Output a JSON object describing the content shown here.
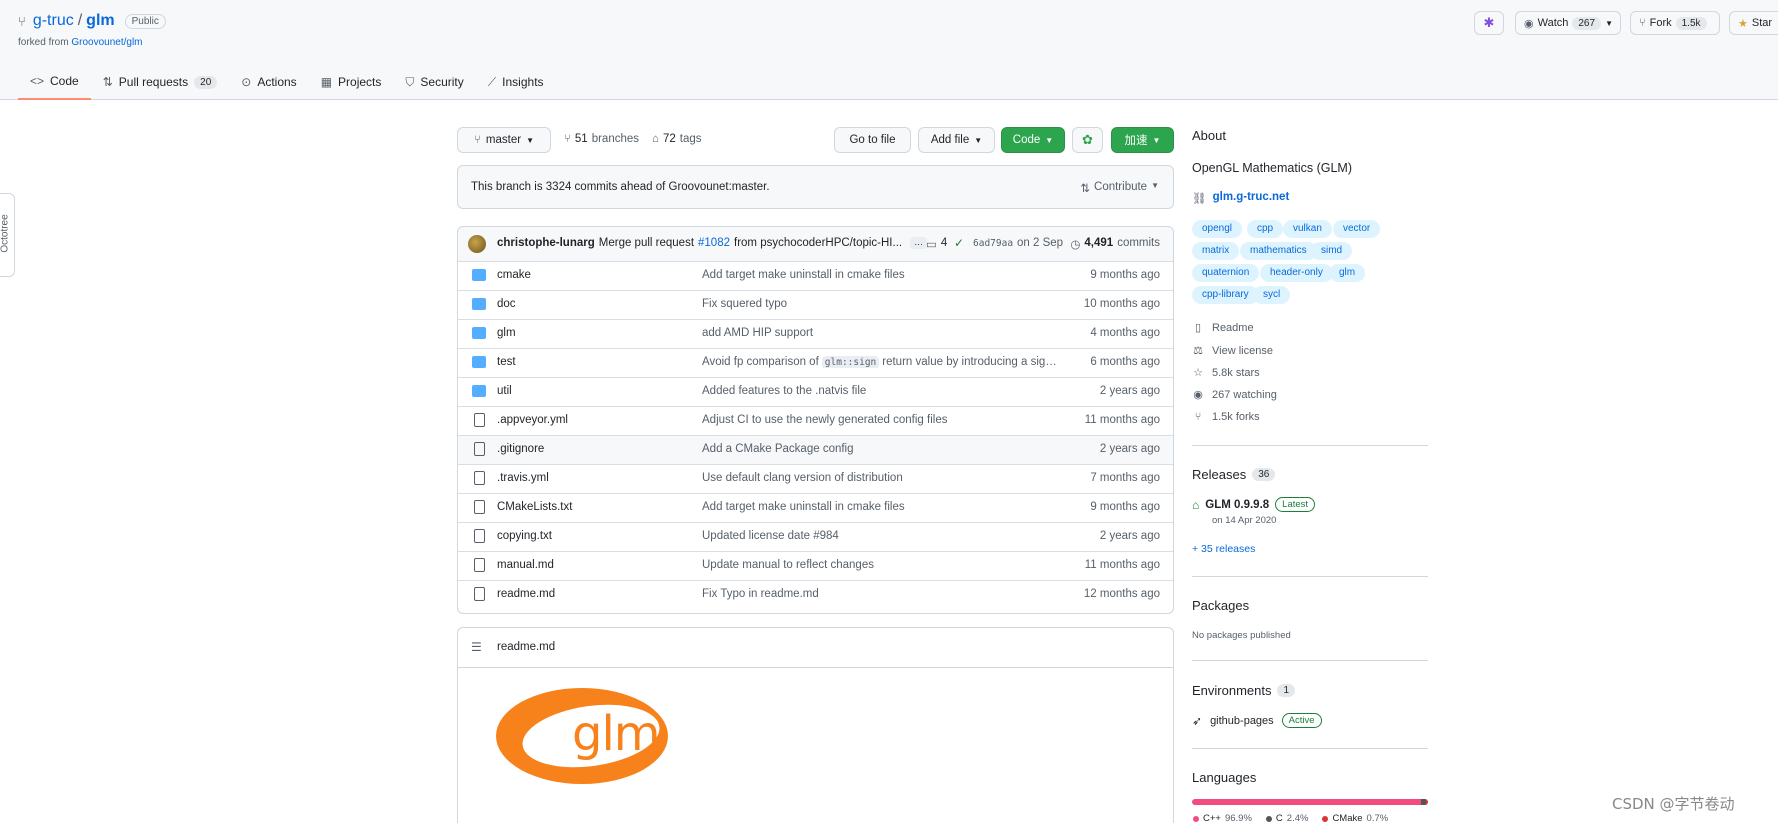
{
  "repo": {
    "owner": "g-truc",
    "separator": "/",
    "name": "glm",
    "visibility": "Public",
    "forked_prefix": "forked from",
    "forked_from": "Groovounet/glm"
  },
  "header_actions": {
    "watch_label": "Watch",
    "watch_count": "267",
    "fork_label": "Fork",
    "fork_count": "1.5k",
    "star_label": "Star"
  },
  "tabs": [
    {
      "label": "Code",
      "icon": "code-icon"
    },
    {
      "label": "Pull requests",
      "count": "20",
      "icon": "pull-request-icon"
    },
    {
      "label": "Actions",
      "icon": "play-icon"
    },
    {
      "label": "Projects",
      "icon": "table-icon"
    },
    {
      "label": "Security",
      "icon": "shield-icon"
    },
    {
      "label": "Insights",
      "icon": "graph-icon"
    }
  ],
  "octotree": {
    "label": "Octotree"
  },
  "toolbar": {
    "branch": "master",
    "branches_count": "51",
    "branches_label": "branches",
    "tags_count": "72",
    "tags_label": "tags",
    "go_to_file": "Go to file",
    "add_file": "Add file",
    "code": "Code",
    "accelerate": "加速"
  },
  "branch_info": {
    "text": "This branch is 3324 commits ahead of Groovounet:master.",
    "contribute": "Contribute"
  },
  "latest_commit": {
    "author": "christophe-lunarg",
    "message_prefix": "Merge pull request",
    "pr_link": "#1082",
    "message_suffix": "from psychocoderHPC/topic-HI...",
    "ellipsis": "…",
    "comments": "4",
    "sha": "6ad79aa",
    "date": "on 2 Sep",
    "commits_count": "4,491",
    "commits_label": "commits"
  },
  "files": [
    {
      "type": "folder",
      "name": "cmake",
      "message": "Add target make uninstall in cmake files",
      "time": "9 months ago"
    },
    {
      "type": "folder",
      "name": "doc",
      "message": "Fix squered typo",
      "time": "10 months ago"
    },
    {
      "type": "folder",
      "name": "glm",
      "message": "add AMD HIP support",
      "time": "4 months ago"
    },
    {
      "type": "folder",
      "name": "test",
      "message_pre": "Avoid fp comparison of",
      "message_code": "glm::sign",
      "message_post": "return value by introducing a sign...",
      "time": "6 months ago"
    },
    {
      "type": "folder",
      "name": "util",
      "message": "Added features to the .natvis file",
      "time": "2 years ago"
    },
    {
      "type": "file",
      "name": ".appveyor.yml",
      "message": "Adjust CI to use the newly generated config files",
      "time": "11 months ago"
    },
    {
      "type": "file",
      "name": ".gitignore",
      "message": "Add a CMake Package config",
      "time": "2 years ago"
    },
    {
      "type": "file",
      "name": ".travis.yml",
      "message": "Use default clang version of distribution",
      "time": "7 months ago"
    },
    {
      "type": "file",
      "name": "CMakeLists.txt",
      "message": "Add target make uninstall in cmake files",
      "time": "9 months ago"
    },
    {
      "type": "file",
      "name": "copying.txt",
      "message": "Updated license date #984",
      "time": "2 years ago"
    },
    {
      "type": "file",
      "name": "manual.md",
      "message": "Update manual to reflect changes",
      "time": "11 months ago"
    },
    {
      "type": "file",
      "name": "readme.md",
      "message": "Fix Typo in readme.md",
      "time": "12 months ago"
    }
  ],
  "readme": {
    "filename": "readme.md",
    "logo_text": "glm",
    "logo_color": "#f7821b"
  },
  "about": {
    "title": "About",
    "description": "OpenGL Mathematics (GLM)",
    "website": "glm.g-truc.net",
    "topics": [
      "opengl",
      "cpp",
      "vulkan",
      "vector",
      "matrix",
      "mathematics",
      "simd",
      "quaternion",
      "header-only",
      "glm",
      "cpp-library",
      "sycl"
    ],
    "readme": "Readme",
    "license": "View license",
    "stars": "5.8k stars",
    "watching": "267 watching",
    "forks": "1.5k forks"
  },
  "releases": {
    "title": "Releases",
    "count": "36",
    "latest_name": "GLM 0.9.9.8",
    "latest_badge": "Latest",
    "latest_date": "on 14 Apr 2020",
    "more": "+ 35 releases"
  },
  "packages": {
    "title": "Packages",
    "text": "No packages published"
  },
  "environments": {
    "title": "Environments",
    "count": "1",
    "name": "github-pages",
    "status": "Active"
  },
  "languages": {
    "title": "Languages",
    "items": [
      {
        "name": "C++",
        "percent": "96.9%",
        "value": 96.9,
        "color": "#f34b7d"
      },
      {
        "name": "C",
        "percent": "2.4%",
        "value": 2.4,
        "color": "#555555"
      },
      {
        "name": "CMake",
        "percent": "0.7%",
        "value": 0.7,
        "color": "#da3434"
      }
    ]
  },
  "watermark": "CSDN @字节卷动"
}
